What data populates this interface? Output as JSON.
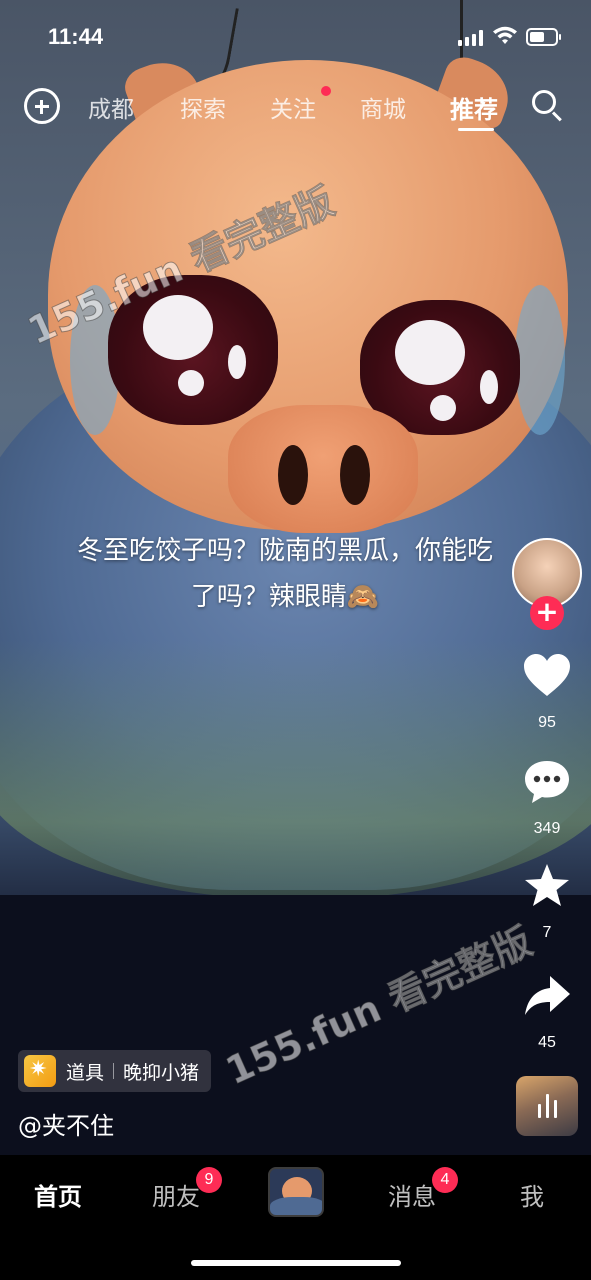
{
  "status_bar": {
    "time": "11:44"
  },
  "top_nav": {
    "tabs": [
      {
        "label": "成都"
      },
      {
        "label": "探索"
      },
      {
        "label": "关注"
      },
      {
        "label": "商城"
      },
      {
        "label": "推荐"
      }
    ],
    "active_tab": "推荐"
  },
  "watermark": {
    "text": "155.fun 看完整版"
  },
  "video": {
    "caption_line1": "冬至吃饺子吗？陇南的黑瓜，你能吃",
    "caption_line2": "了吗？辣眼睛🙈"
  },
  "actions": {
    "likes": "95",
    "comments": "349",
    "favorites": "7",
    "shares": "45"
  },
  "prop": {
    "label": "道具",
    "name": "晚抑小猪"
  },
  "author": {
    "username": "@夹不住"
  },
  "bottom_nav": {
    "home": "首页",
    "friends": "朋友",
    "friends_badge": "9",
    "messages": "消息",
    "messages_badge": "4",
    "me": "我"
  },
  "colors": {
    "accent": "#fe2c55"
  }
}
